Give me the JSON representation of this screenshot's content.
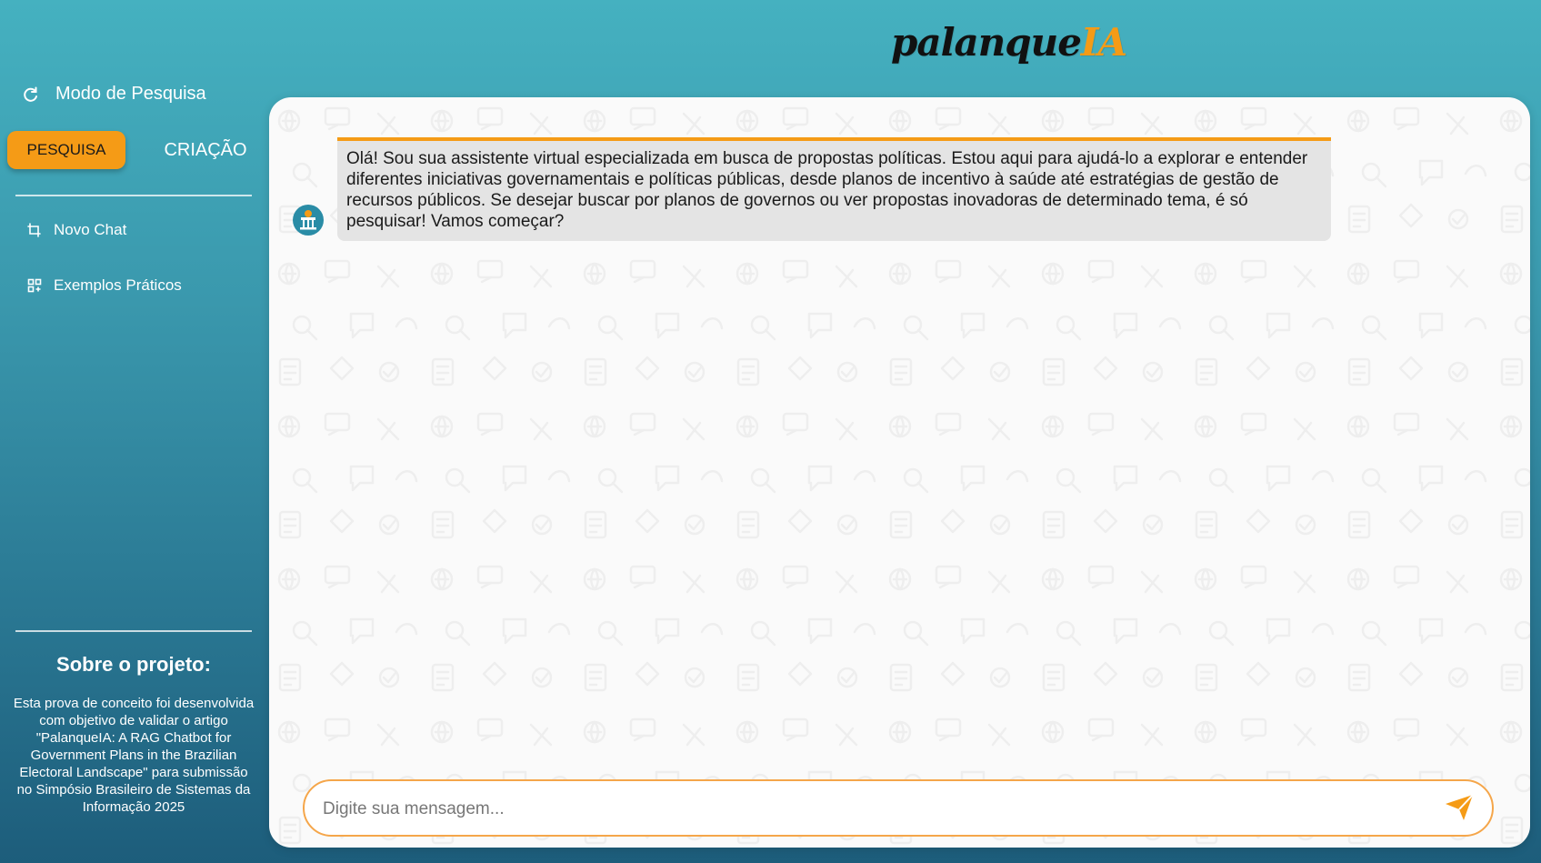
{
  "header": {
    "logo_prefix": "palanque",
    "logo_suffix": "IA"
  },
  "sidebar": {
    "mode_title": "Modo de Pesquisa",
    "mode_icon": "refresh-icon",
    "modes": [
      {
        "label": "PESQUISA",
        "active": true
      },
      {
        "label": "CRIAÇÃO",
        "active": false
      }
    ],
    "nav": [
      {
        "label": "Novo Chat",
        "icon": "new-chat-icon"
      },
      {
        "label": "Exemplos Práticos",
        "icon": "grid-icon"
      }
    ],
    "about": {
      "title": "Sobre o projeto:",
      "text": "Esta prova de conceito foi desenvolvida com objetivo de validar o artigo \"PalanqueIA: A RAG Chatbot for Government Plans in the Brazilian Electoral Landscape\" para submissão no Simpósio Brasileiro de Sistemas da Informação 2025"
    }
  },
  "chat": {
    "messages": [
      {
        "role": "assistant",
        "avatar_icon": "column-avatar-icon",
        "text": "Olá! Sou sua assistente virtual especializada em busca de propostas políticas. Estou aqui para ajudá-lo a explorar e entender diferentes iniciativas governamentais e políticas públicas, desde planos de incentivo à saúde até estratégias de gestão de recursos públicos. Se desejar buscar por planos de governos ou ver propostas inovadoras de determinado tema, é só pesquisar! Vamos começar?"
      }
    ],
    "input": {
      "placeholder": "Digite sua mensagem...",
      "value": ""
    },
    "send_icon": "send-icon"
  },
  "colors": {
    "accent": "#f59b16",
    "bubble_bg": "#e4e4e4",
    "gradient_top": "#45b1c0",
    "gradient_bottom": "#1d5d7b"
  }
}
